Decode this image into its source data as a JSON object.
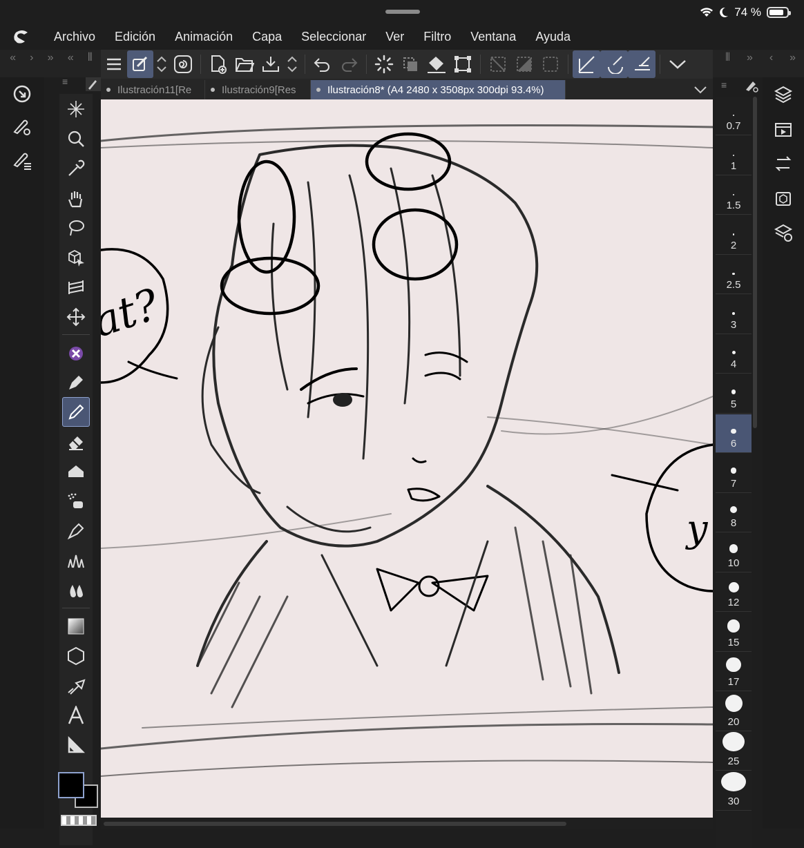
{
  "status": {
    "battery": "74 %"
  },
  "menu": [
    "Archivo",
    "Edición",
    "Animación",
    "Capa",
    "Seleccionar",
    "Ver",
    "Filtro",
    "Ventana",
    "Ayuda"
  ],
  "tabs": [
    {
      "label": "Ilustración11[Re",
      "active": false
    },
    {
      "label": "Ilustración9[Res",
      "active": false
    },
    {
      "label": "Ilustración8* (A4 2480 x 3508px 300dpi 93.4%)",
      "active": true
    }
  ],
  "canvas_text": {
    "left_bubble": "at?",
    "right_bubble": "y"
  },
  "brush_sizes": [
    "0.7",
    "1",
    "1.5",
    "2",
    "2.5",
    "3",
    "4",
    "5",
    "6",
    "7",
    "8",
    "10",
    "12",
    "15",
    "17",
    "20",
    "25",
    "30"
  ],
  "brush_selected": "6",
  "colors": {
    "main": "#000000",
    "sub": "#000000",
    "accent": "#4f5b78",
    "canvas_bg": "#efe6e6"
  },
  "tools": [
    "magic-wand-icon",
    "zoom-icon",
    "eyedropper-icon",
    "hand-icon",
    "lasso-icon",
    "3d-operation-icon",
    "layer-move-icon",
    "move-icon",
    "sub-tool-icon",
    "pen-icon",
    "pencil-icon",
    "eraser-icon",
    "fill-icon",
    "airbrush-icon",
    "ink-pen-icon",
    "decoration-icon",
    "blend-icon",
    "gradient-icon",
    "shape-icon",
    "frame-icon",
    "text-icon",
    "ruler-icon"
  ],
  "right_rail": [
    "layers-icon",
    "animation-icon",
    "layer-property-icon",
    "material-icon",
    "sub-tool-detail-icon"
  ],
  "left_rail": [
    "clip-studio-icon",
    "settings-brush-icon",
    "history-icon"
  ]
}
